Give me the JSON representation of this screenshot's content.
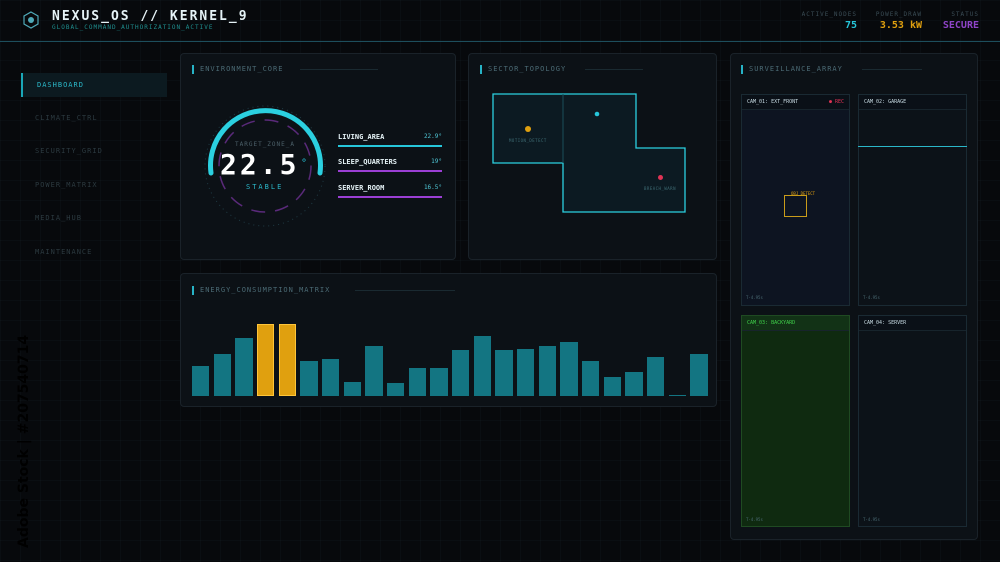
{
  "header": {
    "title": "NEXUS_OS // KERNEL_9",
    "subtitle": "GLOBAL_COMMAND_AUTHORIZATION_ACTIVE",
    "stats": [
      {
        "label": "ACTIVE_NODES",
        "value": "75",
        "color": "#26c6da"
      },
      {
        "label": "POWER_DRAW",
        "value": "3.53 kW",
        "color": "#e0a00f"
      },
      {
        "label": "STATUS",
        "value": "SECURE",
        "color": "#8e44c8"
      }
    ]
  },
  "sidebar": {
    "items": [
      {
        "label": "DASHBOARD",
        "active": true
      },
      {
        "label": "CLIMATE_CTRL",
        "active": false
      },
      {
        "label": "SECURITY_GRID",
        "active": false
      },
      {
        "label": "POWER_MATRIX",
        "active": false
      },
      {
        "label": "MEDIA_HUB",
        "active": false
      },
      {
        "label": "MAINTENANCE",
        "active": false
      }
    ]
  },
  "environment": {
    "title": "ENVIRONMENT_CORE",
    "target_label": "TARGET_ZONE_A",
    "temperature": "22.5",
    "degree": "°",
    "state": "STABLE",
    "zones": [
      {
        "label": "LIVING_AREA",
        "value": "22.9°",
        "color": "#26c6da"
      },
      {
        "label": "SLEEP_QUARTERS",
        "value": "19°",
        "color": "#9b3fd4"
      },
      {
        "label": "SERVER_ROOM",
        "value": "16.5°",
        "color": "#9b3fd4"
      }
    ]
  },
  "topology": {
    "title": "SECTOR_TOPOLOGY",
    "markers": [
      {
        "label": "MOTION_DETECT",
        "color": "#e0a00f"
      },
      {
        "label": "",
        "color": "#26c6da"
      },
      {
        "label": "BREACH_WARN",
        "color": "#e03355"
      }
    ]
  },
  "surveillance": {
    "title": "SURVEILLANCE_ARRAY",
    "cams": [
      {
        "label": "CAM_01: EXT_FRONT",
        "rec": "● REC",
        "time": "T-4.95s",
        "detect": "OBJ_DETECT"
      },
      {
        "label": "CAM_02: GARAGE",
        "rec": "",
        "time": "T-4.95s",
        "detect": ""
      },
      {
        "label": "CAM_03: BACKYARD",
        "rec": "",
        "time": "T-4.95s",
        "detect": ""
      },
      {
        "label": "CAM_04: SERVER",
        "rec": "",
        "time": "T-4.95s",
        "detect": ""
      }
    ]
  },
  "energy": {
    "title": "ENERGY_CONSUMPTION_MATRIX"
  },
  "chart_data": {
    "type": "bar",
    "values": [
      30,
      42,
      58,
      72,
      72,
      35,
      37,
      14,
      50,
      13,
      28,
      28,
      46,
      60,
      46,
      47,
      50,
      54,
      35,
      19,
      24,
      39,
      1,
      42
    ],
    "highlight": [
      3,
      4
    ],
    "colors": {
      "normal": "#137582",
      "highlight": "#e0a00f"
    }
  },
  "watermark": {
    "text": "Adobe Stock | #207540714"
  }
}
